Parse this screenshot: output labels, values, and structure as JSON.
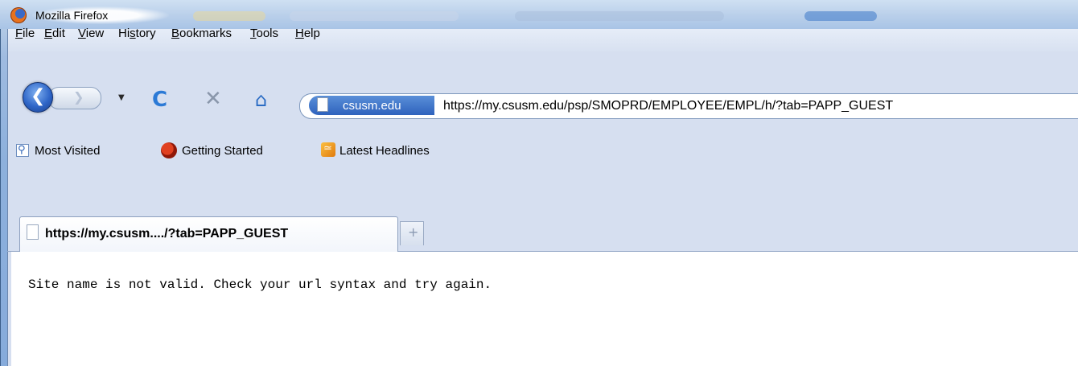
{
  "window": {
    "title": "Mozilla Firefox"
  },
  "menu": {
    "items": [
      {
        "label": "File",
        "mnemonic": "F",
        "rest": "ile"
      },
      {
        "label": "Edit",
        "mnemonic": "E",
        "rest": "dit"
      },
      {
        "label": "View",
        "mnemonic": "V",
        "rest": "iew"
      },
      {
        "label": "History",
        "pre": "Hi",
        "mnemonic": "s",
        "rest": "tory"
      },
      {
        "label": "Bookmarks",
        "mnemonic": "B",
        "rest": "ookmarks"
      },
      {
        "label": "Tools",
        "mnemonic": "T",
        "rest": "ools"
      },
      {
        "label": "Help",
        "mnemonic": "H",
        "rest": "elp"
      }
    ]
  },
  "nav": {
    "site_identity": "csusm.edu",
    "url": "https://my.csusm.edu/psp/SMOPRD/EMPLOYEE/EMPL/h/?tab=PAPP_GUEST",
    "icons": [
      "back-icon",
      "forward-icon",
      "dropdown-icon",
      "reload-icon",
      "stop-icon",
      "home-icon",
      "page-icon"
    ]
  },
  "bookmarks": {
    "items": [
      {
        "label": "Most Visited",
        "icon": "most-visited-icon"
      },
      {
        "label": "Getting Started",
        "icon": "firefox-icon"
      },
      {
        "label": "Latest Headlines",
        "icon": "rss-icon"
      }
    ]
  },
  "tabs": [
    {
      "label": "https://my.csusm..../?tab=PAPP_GUEST",
      "active": true
    }
  ],
  "newtab_symbol": "+",
  "page": {
    "message": "Site name is not valid. Check your url syntax and try again."
  },
  "colors": {
    "site_identity_bg": "#2e62bd",
    "reload": "#2c7ad6",
    "stop": "#8a97ab",
    "home": "#2b6cc4"
  }
}
